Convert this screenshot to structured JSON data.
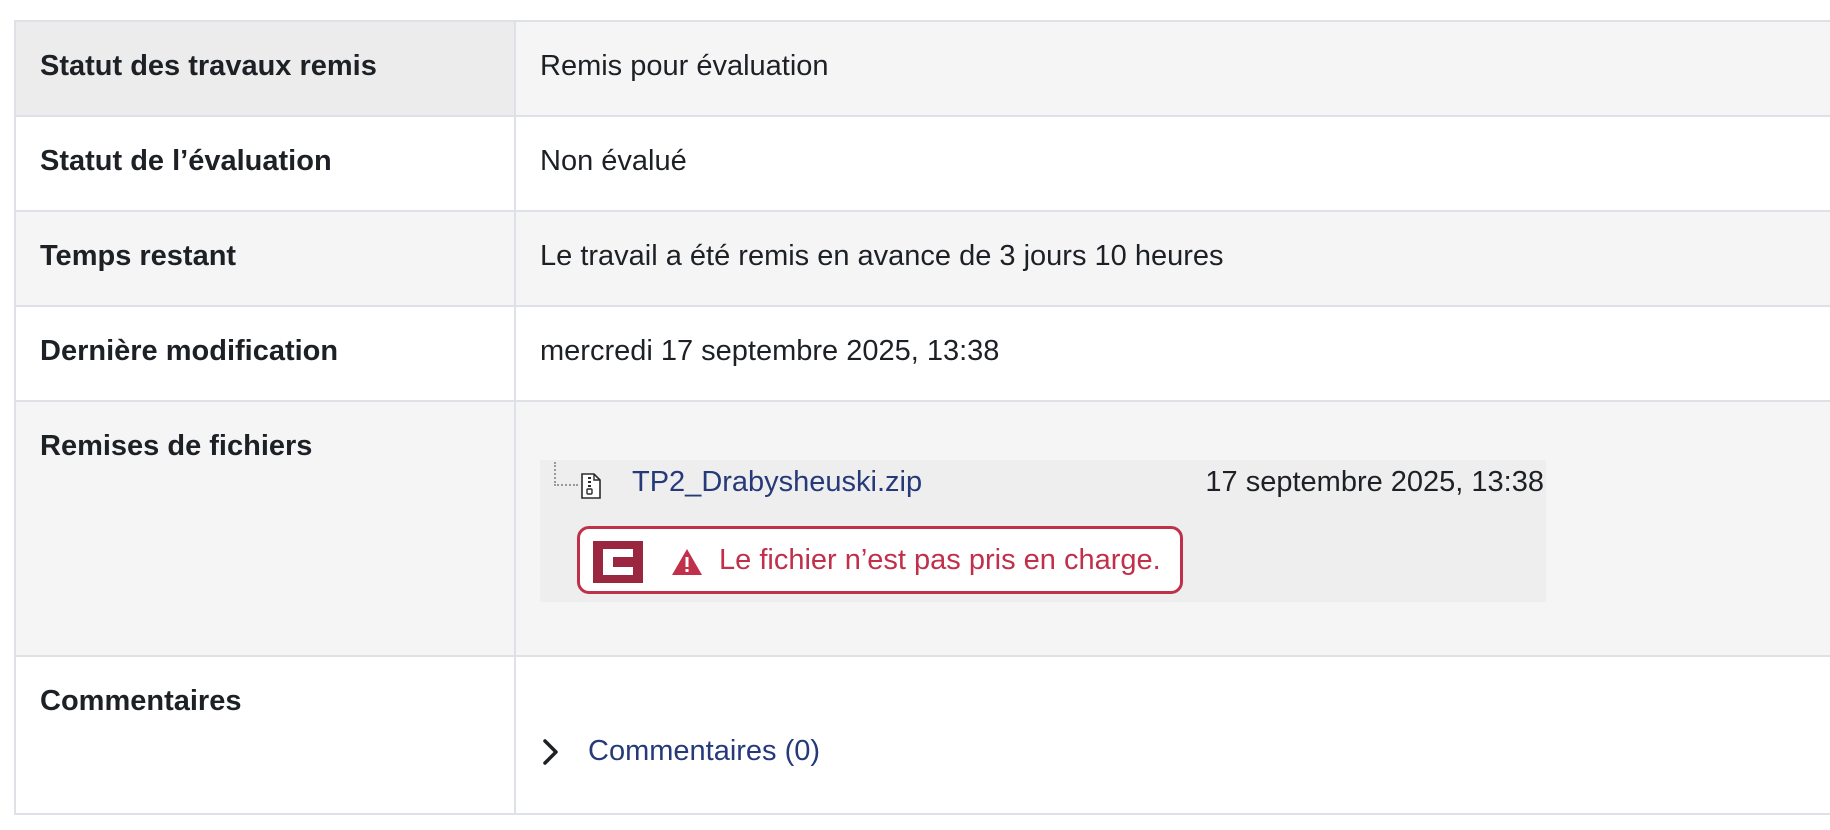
{
  "rows": [
    {
      "label": "Statut des travaux remis",
      "value": "Remis pour évaluation"
    },
    {
      "label": "Statut de l’évaluation",
      "value": "Non évalué"
    },
    {
      "label": "Temps restant",
      "value": "Le travail a été remis en avance de 3 jours 10 heures"
    },
    {
      "label": "Dernière modification",
      "value": "mercredi 17 septembre 2025, 13:38"
    }
  ],
  "files": {
    "label": "Remises de fichiers",
    "file_name": "TP2_Drabysheuski.zip",
    "file_date": "17 septembre 2025, 13:38",
    "warning": "Le fichier n’est pas pris en charge.",
    "icons": {
      "file": "zip-file-icon",
      "warning": "warning-triangle-icon",
      "logo": "c-logo-icon"
    }
  },
  "comments": {
    "label": "Commentaires",
    "link": "Commentaires (0)"
  },
  "colors": {
    "success_bg": "#d5eed3",
    "link": "#263a7a",
    "danger": "#c1304a",
    "logo": "#9b2640"
  }
}
